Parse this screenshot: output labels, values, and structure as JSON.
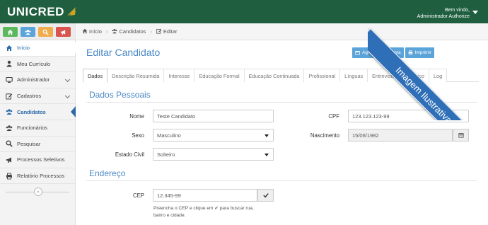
{
  "app": {
    "logo_text": "UNICRED",
    "user_greeting": "Bem vindo,",
    "user_name": "Administrador Authorize"
  },
  "ribbon": {
    "text": "Imagem Ilustrativa"
  },
  "quick_actions": [
    {
      "icon": "home-icon",
      "color": "#5cb85c"
    },
    {
      "icon": "users-icon",
      "color": "#5ba4d9"
    },
    {
      "icon": "search-icon",
      "color": "#f0ad4e"
    },
    {
      "icon": "bullhorn-icon",
      "color": "#d9534f"
    }
  ],
  "sidebar": {
    "items": [
      {
        "label": "Início",
        "icon": "home-icon",
        "has_chevron": false
      },
      {
        "label": "Meu Currículo",
        "icon": "user-icon",
        "has_chevron": false
      },
      {
        "label": "Administrador",
        "icon": "desktop-icon",
        "has_chevron": true
      },
      {
        "label": "Cadastros",
        "icon": "edit-icon",
        "has_chevron": true
      },
      {
        "label": "Candidatos",
        "icon": "users-icon",
        "has_chevron": false
      },
      {
        "label": "Funcionários",
        "icon": "users-icon",
        "has_chevron": false
      },
      {
        "label": "Pesquisar",
        "icon": "search-icon",
        "has_chevron": false
      },
      {
        "label": "Processos Seletivos",
        "icon": "bullhorn-icon",
        "has_chevron": false
      },
      {
        "label": "Relatório Processos",
        "icon": "print-icon",
        "has_chevron": false
      }
    ],
    "collapse_symbol": "«"
  },
  "breadcrumb": {
    "items": [
      "Início",
      "Candidatos",
      "Editar"
    ],
    "separator": "›"
  },
  "page": {
    "title": "Editar Candidato",
    "actions": [
      {
        "label": "Agendar entrevista",
        "icon": "calendar-icon"
      },
      {
        "label": "Imprimir",
        "icon": "print-icon"
      }
    ]
  },
  "tabs": [
    "Dados",
    "Descrição Resumida",
    "Interesse",
    "Educação Formal",
    "Educação Continuada",
    "Profissional",
    "Línguas",
    "Entrevista",
    "Histórico",
    "Log"
  ],
  "personal": {
    "section_title": "Dados Pessoais",
    "nome_label": "Nome",
    "nome_value": "Teste Candidato",
    "cpf_label": "CPF",
    "cpf_value": "123.123.123-99",
    "sexo_label": "Sexo",
    "sexo_value": "Masculino",
    "nascimento_label": "Nascimento",
    "nascimento_value": "15/06/1982",
    "estado_civil_label": "Estado Civil",
    "estado_civil_value": "Solteiro"
  },
  "address": {
    "section_title": "Endereço",
    "cep_label": "CEP",
    "cep_value": "12.345-99",
    "help_line1": "Preencha o CEP e clique em ✔ para buscar rua,",
    "help_line2": "bairro e cidade."
  }
}
